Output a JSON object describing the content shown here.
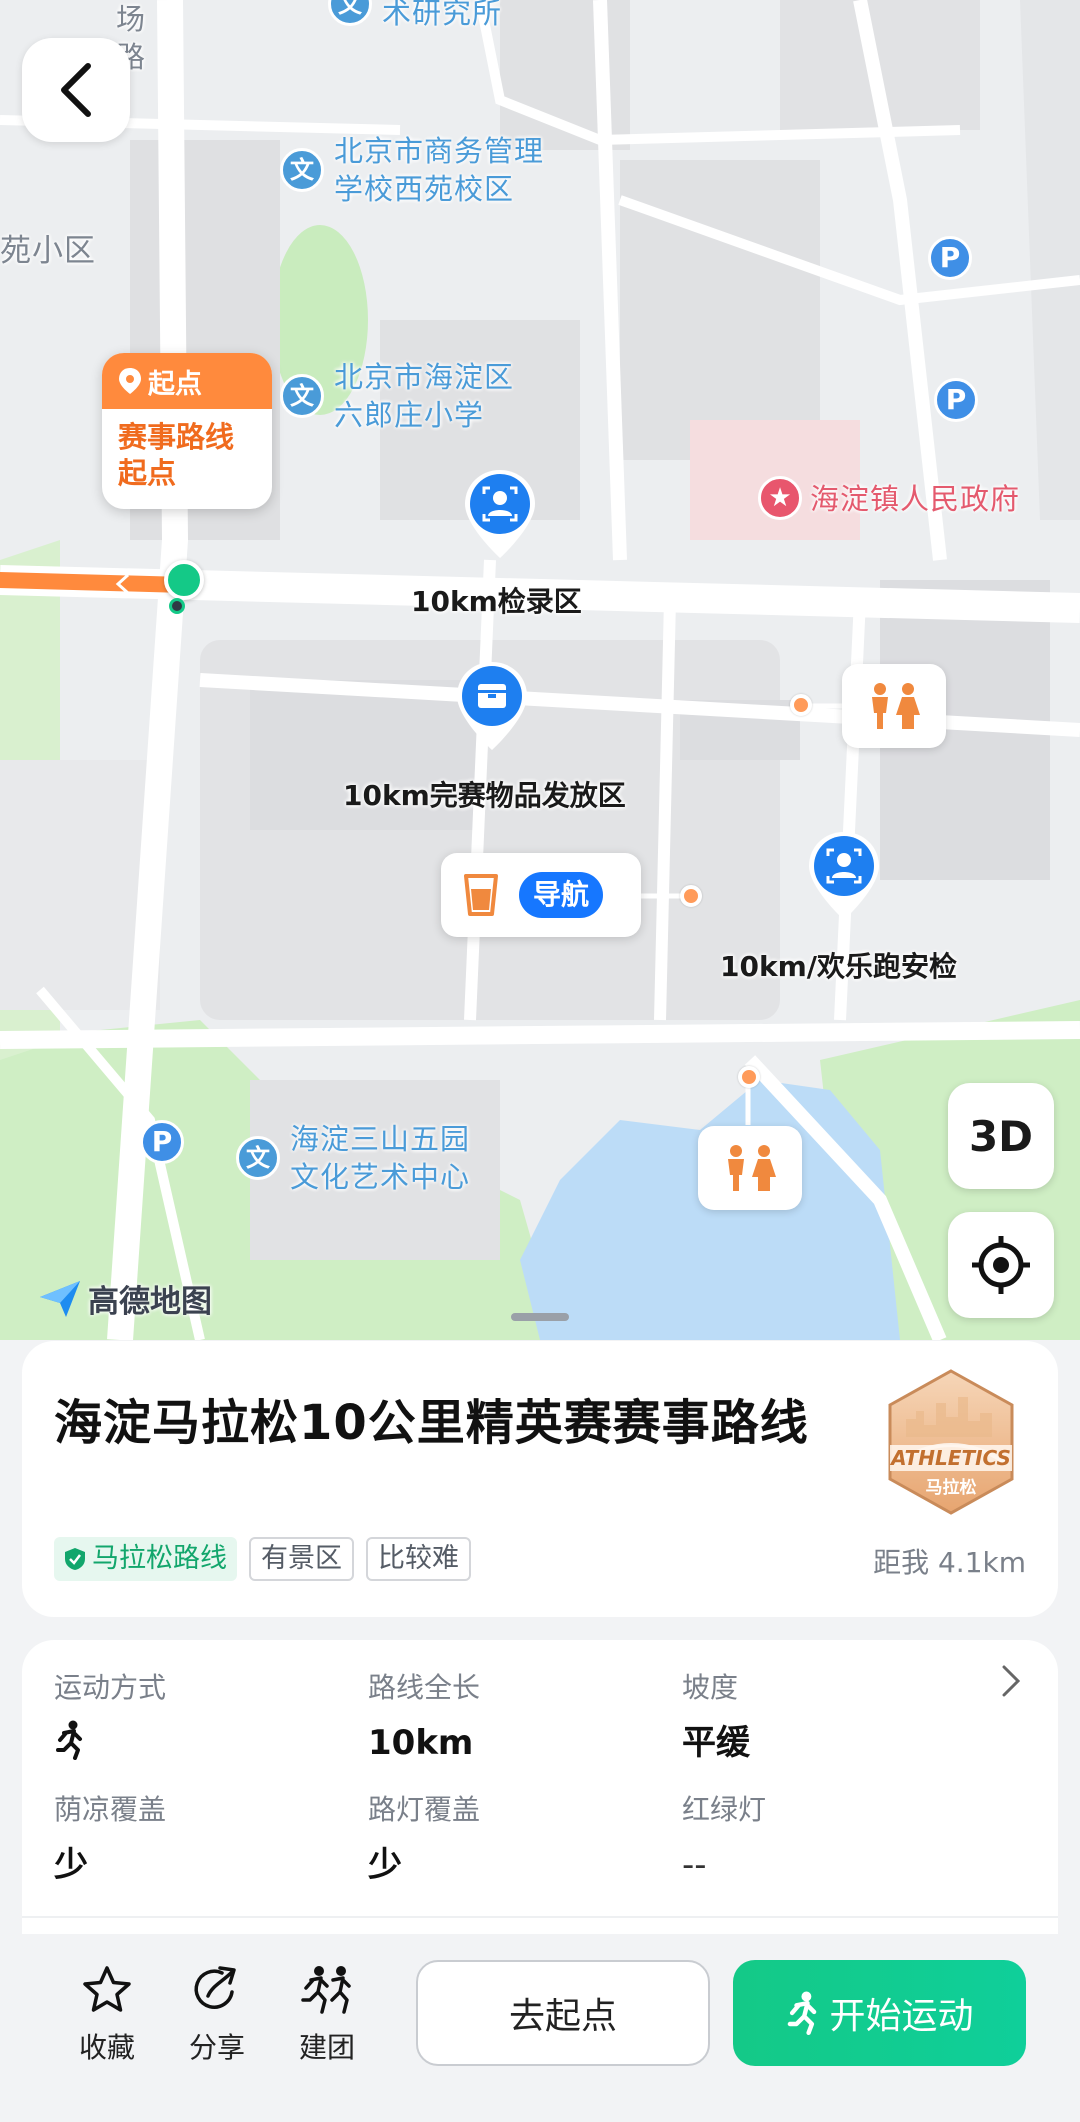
{
  "map": {
    "labels": {
      "road_top": "场\n路",
      "institute": "术研究所",
      "school_west": "北京市商务管理\n学校西苑校区",
      "residential": "苑小区",
      "primary_school": "北京市海淀区\n六郎庄小学",
      "government": "海淀镇人民政府",
      "culture_center": "海淀三山五园\n文化艺术中心",
      "culture_glyph": "文",
      "parking_glyph": "P"
    },
    "start_card": {
      "head": "起点",
      "body": "赛事路线\n起点"
    },
    "markers": {
      "checkin": "10km检录区",
      "finish_items": "10km完赛物品发放区",
      "security": "10km/欢乐跑安检"
    },
    "water_station": {
      "nav_label": "导航"
    },
    "buttons": {
      "three_d": "3D"
    },
    "logo": "高德地图"
  },
  "route": {
    "title": "海淀马拉松10公里精英赛赛事路线",
    "badge": {
      "top": "ATHLETICS",
      "bottom": "马拉松"
    },
    "tags": [
      "马拉松路线",
      "有景区",
      "比较难"
    ],
    "distance": "距我 4.1km"
  },
  "stats": [
    {
      "label": "运动方式",
      "value": "",
      "icon": "running-person-icon"
    },
    {
      "label": "路线全长",
      "value": "10km"
    },
    {
      "label": "坡度",
      "value": "平缓"
    },
    {
      "label": "荫凉覆盖",
      "value": "少"
    },
    {
      "label": "路灯覆盖",
      "value": "少"
    },
    {
      "label": "红绿灯",
      "value": "--"
    }
  ],
  "bottom_bar": {
    "favorite": "收藏",
    "share": "分享",
    "group": "建团",
    "go_start": "去起点",
    "start_exercise": "开始运动"
  },
  "colors": {
    "accent_green": "#14c987",
    "route_orange": "#ff8a3d",
    "poi_blue": "#1e7ff0"
  }
}
